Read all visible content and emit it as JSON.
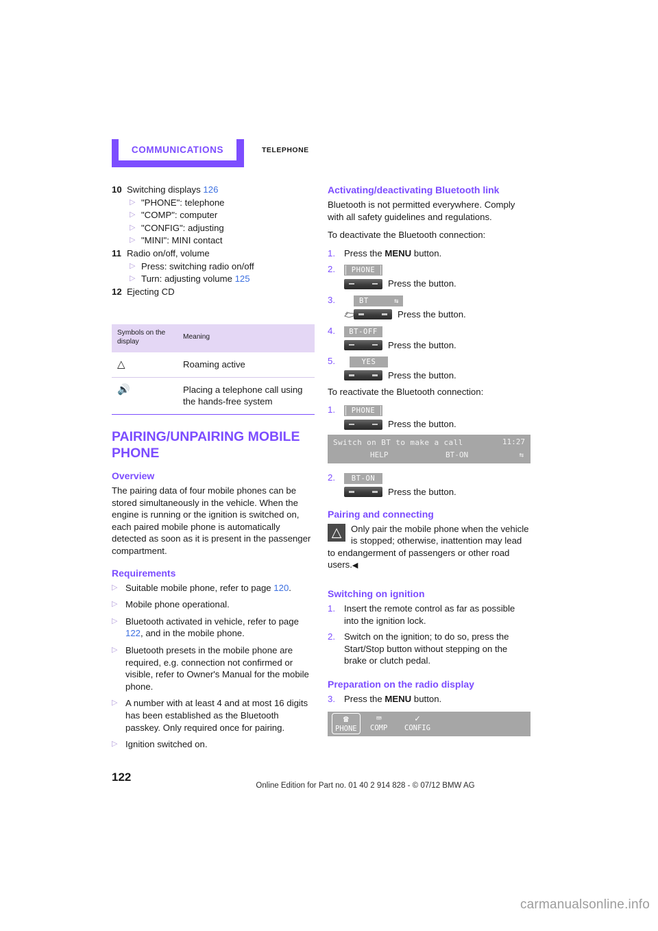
{
  "header": {
    "chapter": "COMMUNICATIONS",
    "section": "TELEPHONE"
  },
  "left_column": {
    "legend": [
      {
        "num": "10",
        "text": "Switching displays",
        "page_ref": "126",
        "subitems": [
          "\"PHONE\": telephone",
          "\"COMP\": computer",
          "\"CONFIG\": adjusting",
          "\"MINI\": MINI contact"
        ]
      },
      {
        "num": "11",
        "text": "Radio on/off, volume",
        "page_ref": "",
        "subitems": [
          "Press: switching radio on/off"
        ],
        "subitems_with_ref": [
          {
            "text": "Turn: adjusting volume",
            "page_ref": "125"
          }
        ]
      },
      {
        "num": "12",
        "text": "Ejecting CD",
        "page_ref": "",
        "subitems": []
      }
    ],
    "table": {
      "headers": [
        "Symbols on the display",
        "Meaning"
      ],
      "rows": [
        {
          "symbol": "△",
          "symbol_name": "roaming-triangle-icon",
          "meaning": "Roaming active"
        },
        {
          "symbol": "🔊",
          "symbol_name": "speaker-icon",
          "meaning": "Placing a telephone call using the hands-free system"
        }
      ]
    },
    "chapter_title": "PAIRING/UNPAIRING MOBILE PHONE",
    "overview": {
      "heading": "Overview",
      "text": "The pairing data of four mobile phones can be stored simultaneously in the vehicle. When the engine is running or the ignition is switched on, each paired mobile phone is automatically detected as soon as it is present in the passenger compartment."
    },
    "requirements": {
      "heading": "Requirements",
      "items": [
        {
          "pre": "Suitable mobile phone, refer to page ",
          "ref": "120",
          "post": "."
        },
        {
          "pre": "Mobile phone operational.",
          "ref": "",
          "post": ""
        },
        {
          "pre": "Bluetooth activated in vehicle, refer to page ",
          "ref": "122",
          "post": ", and in the mobile phone."
        },
        {
          "pre": "Bluetooth presets in the mobile phone are required, e.g. connection not confirmed or visible, refer to Owner's Manual for the mobile phone.",
          "ref": "",
          "post": ""
        },
        {
          "pre": "A number with at least 4 and at most 16 digits has been established as the Bluetooth passkey. Only required once for pairing.",
          "ref": "",
          "post": ""
        },
        {
          "pre": "Ignition switched on.",
          "ref": "",
          "post": ""
        }
      ]
    }
  },
  "right_column": {
    "activating": {
      "heading": "Activating/deactivating Bluetooth link",
      "intro": "Bluetooth is not permitted everywhere. Comply with all safety guidelines and regulations.",
      "deactivate_lead": "To deactivate the Bluetooth connection:",
      "deactivate_steps": [
        {
          "num": "1.",
          "type": "text",
          "text_pre": "Press the ",
          "bold": "MENU",
          "text_post": " button."
        },
        {
          "num": "2.",
          "type": "button",
          "chip": "PHONE",
          "label": "Press the button."
        },
        {
          "num": "3.",
          "type": "button_hand",
          "chip": "BT",
          "chip_extra": "⇆",
          "label": "Press the button."
        },
        {
          "num": "4.",
          "type": "button",
          "chip": "BT-OFF",
          "label": "Press the button."
        },
        {
          "num": "5.",
          "type": "button",
          "chip": "YES",
          "label": "Press the button."
        }
      ],
      "reactivate_lead": "To reactivate the Bluetooth connection:",
      "reactivate_steps_a": [
        {
          "num": "1.",
          "type": "button",
          "chip": "PHONE",
          "label": "Press the button."
        }
      ],
      "lcd_display": {
        "line1": "Switch on BT to make a call",
        "time": "11:27",
        "soft_left": "HELP",
        "soft_mid": "BT-ON",
        "soft_right": "⇆"
      },
      "reactivate_steps_b": [
        {
          "num": "2.",
          "type": "button",
          "chip": "BT-ON",
          "label": "Press the button."
        }
      ]
    },
    "pairing": {
      "heading": "Pairing and connecting",
      "warning_icon": "warning-triangle-icon",
      "warning_text": "Only pair the mobile phone when the vehicle is stopped; otherwise, inattention may lead to endangerment of passengers or other road users.",
      "warning_endmark": "◀"
    },
    "ignition": {
      "heading": "Switching on ignition",
      "steps": [
        {
          "num": "1.",
          "text": "Insert the remote control as far as possible into the ignition lock."
        },
        {
          "num": "2.",
          "text": "Switch on the ignition; to do so, press the Start/Stop button without stepping on the brake or clutch pedal."
        }
      ]
    },
    "preparation": {
      "heading": "Preparation on the radio display",
      "step": {
        "num": "3.",
        "text_pre": "Press the ",
        "bold": "MENU",
        "text_post": " button."
      },
      "menu_display": {
        "items": [
          {
            "label": "PHONE",
            "glyph": "☎",
            "selected": true
          },
          {
            "label": "COMP",
            "glyph": "⌨",
            "selected": false
          },
          {
            "label": "CONFIG",
            "glyph": "✓",
            "selected": false
          }
        ]
      }
    }
  },
  "footer": {
    "page_number": "122",
    "imprint": "Online Edition for Part no. 01 40 2 914 828 - © 07/12 BMW AG",
    "watermark": "carmanualsonline.info"
  },
  "colors": {
    "accent_violet": "#7c4dff",
    "page_ref_blue": "#3b6fe0",
    "table_head_bg": "#e4d7f5",
    "lcd_gray": "#a6a6a6"
  }
}
